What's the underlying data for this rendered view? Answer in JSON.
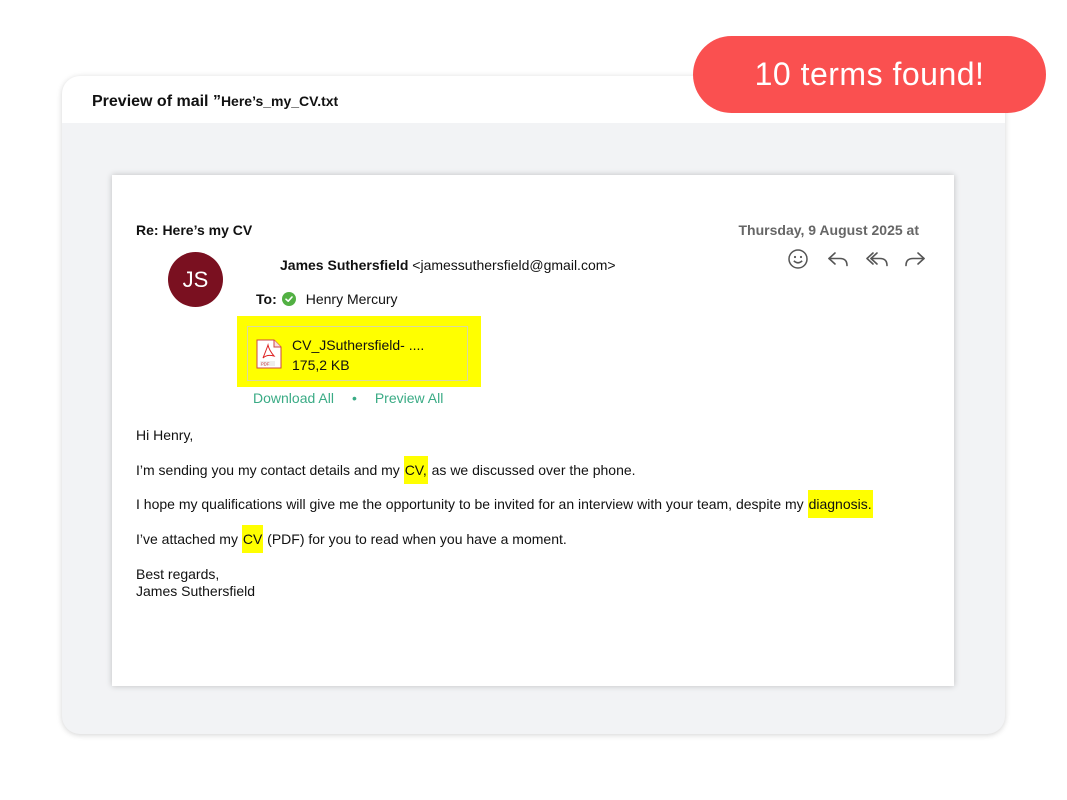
{
  "badge": "10 terms found!",
  "preview": {
    "title_prefix": "Preview of mail ”",
    "file_name": "Here’s_my_CV.txt"
  },
  "mail": {
    "subject": "Re: Here’s my CV",
    "date": "Thursday, 9 August 2025 at",
    "avatar_initials": "JS",
    "sender_name": "James Suthersfield",
    "sender_email": "<jamessuthersfield@gmail.com>",
    "to_label": "To:",
    "recipient": "Henry Mercury",
    "actions": [
      "smiley-icon",
      "reply-icon",
      "reply-all-icon",
      "forward-icon"
    ],
    "attachment": {
      "name": "CV_JSuthersfield- ....",
      "size": "175,2 KB",
      "icon": "pdf-file-icon"
    },
    "download_all": "Download All",
    "separator": "•",
    "preview_all": "Preview All",
    "body": {
      "greeting": "Hi Henry,",
      "line1": {
        "before": "I’m sending you my contact details and my ",
        "hl": "CV,",
        "after": " as we discussed over the phone."
      },
      "line2": {
        "before": "I hope my qualifications will give me the opportunity to be invited for an interview with your team, despite my ",
        "hl": "diagnosis."
      },
      "line3": {
        "before": "I’ve attached my ",
        "hl": "CV",
        "after": " (PDF) for you to read when you have a moment."
      },
      "closing": "Best regards,",
      "signature": "James Suthersfield"
    }
  },
  "colors": {
    "badge": "#fa5050",
    "highlight": "#ffff00",
    "avatar": "#7a1020",
    "link": "#3aab85",
    "check": "#52b043"
  }
}
